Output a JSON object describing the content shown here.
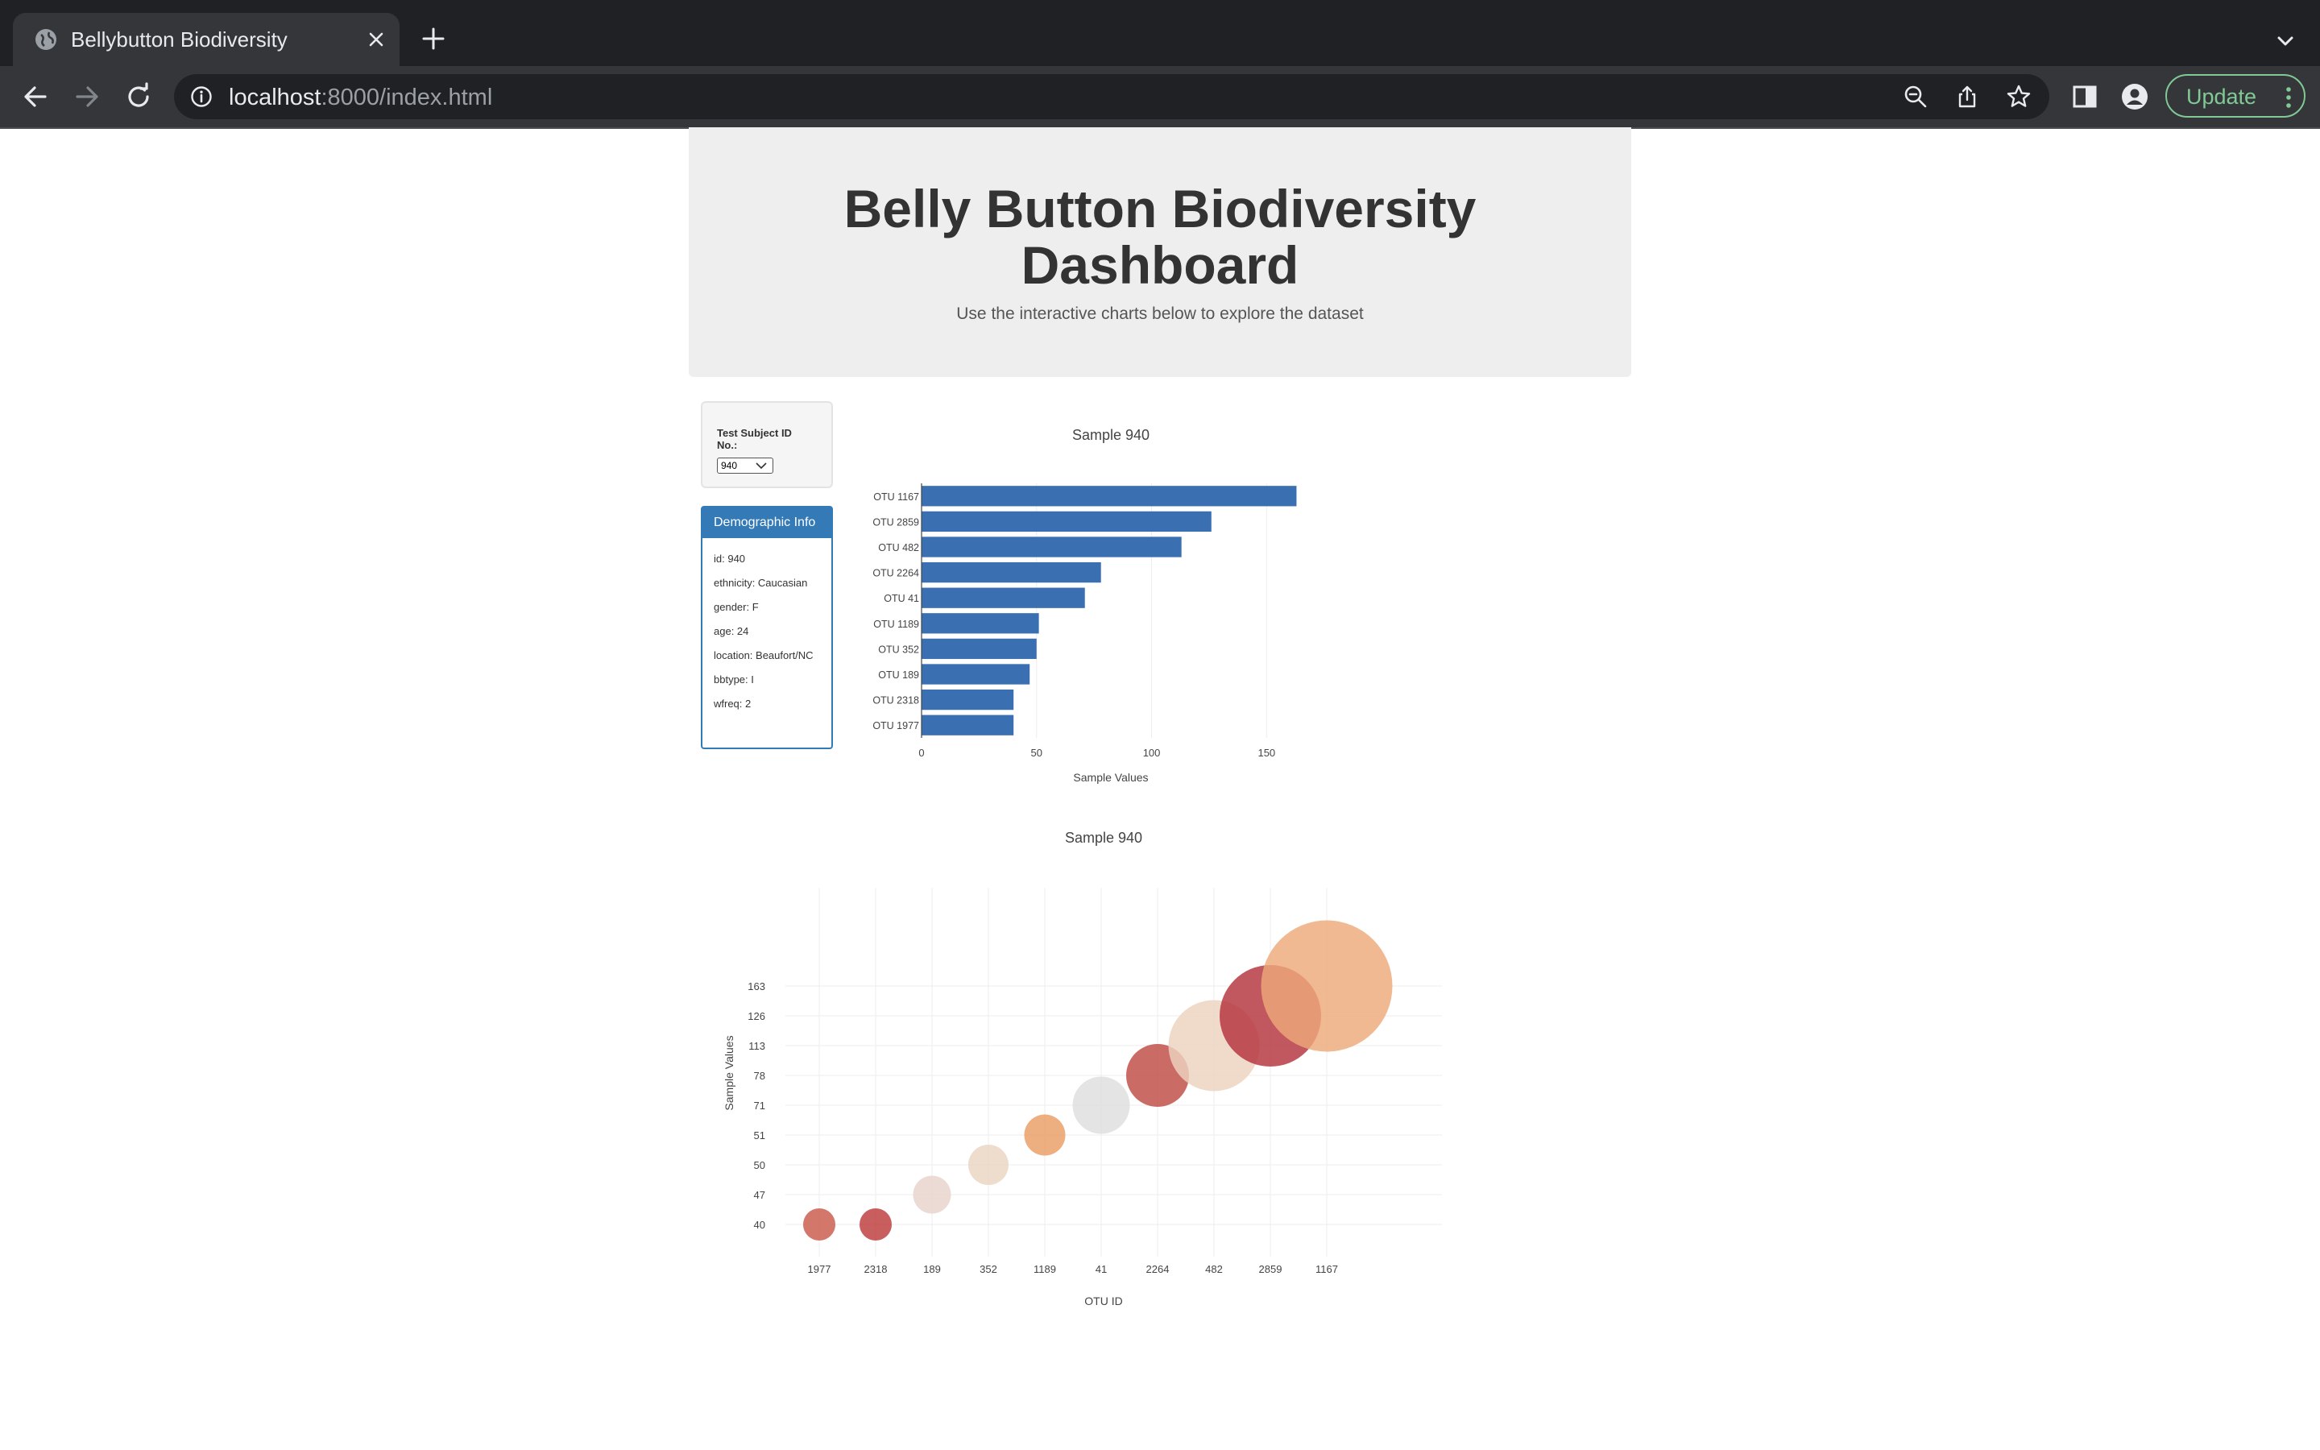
{
  "browser": {
    "tab_title": "Bellybutton Biodiversity",
    "url_host": "localhost",
    "url_rest": ":8000/index.html",
    "update_label": "Update"
  },
  "header": {
    "title_line1": "Belly Button Biodiversity",
    "title_line2": "Dashboard",
    "subtitle": "Use the interactive charts below to explore the dataset"
  },
  "selector": {
    "label": "Test Subject ID No.:",
    "selected": "940"
  },
  "demographics": {
    "heading": "Demographic Info",
    "rows": [
      "id: 940",
      "ethnicity: Caucasian",
      "gender: F",
      "age: 24",
      "location: Beaufort/NC",
      "bbtype: I",
      "wfreq: 2"
    ]
  },
  "chart_data": [
    {
      "type": "bar",
      "orientation": "horizontal",
      "title": "Sample 940",
      "xlabel": "Sample Values",
      "ylabel": "",
      "categories": [
        "OTU 1167",
        "OTU 2859",
        "OTU 482",
        "OTU 2264",
        "OTU 41",
        "OTU 1189",
        "OTU 352",
        "OTU 189",
        "OTU 2318",
        "OTU 1977"
      ],
      "values": [
        163,
        126,
        113,
        78,
        71,
        51,
        50,
        47,
        40,
        40
      ],
      "xticks": [
        0,
        50,
        100,
        150
      ],
      "xlim": [
        0,
        171.6
      ],
      "color": "#3a70b2",
      "grid": true
    },
    {
      "type": "scatter",
      "subtype": "bubble",
      "title": "Sample 940",
      "xlabel": "OTU ID",
      "ylabel": "Sample Values",
      "x_categories": [
        "1977",
        "2318",
        "189",
        "352",
        "1189",
        "41",
        "2264",
        "482",
        "2859",
        "1167"
      ],
      "y_categories": [
        "40",
        "47",
        "50",
        "51",
        "71",
        "78",
        "113",
        "126",
        "163"
      ],
      "points": [
        {
          "x": "1977",
          "y": "40",
          "value": 40
        },
        {
          "x": "2318",
          "y": "40",
          "value": 40
        },
        {
          "x": "189",
          "y": "47",
          "value": 47
        },
        {
          "x": "352",
          "y": "50",
          "value": 50
        },
        {
          "x": "1189",
          "y": "51",
          "value": 51
        },
        {
          "x": "41",
          "y": "71",
          "value": 71
        },
        {
          "x": "2264",
          "y": "78",
          "value": 78
        },
        {
          "x": "482",
          "y": "113",
          "value": 113
        },
        {
          "x": "2859",
          "y": "126",
          "value": 126
        },
        {
          "x": "1167",
          "y": "163",
          "value": 163
        }
      ],
      "colors": [
        "#c9594a",
        "#bd3b3b",
        "#e6d3cb",
        "#ead4c2",
        "#e99c64",
        "#dedede",
        "#c04a44",
        "#edd3c0",
        "#b3323c",
        "#edaa7a"
      ],
      "grid": true
    }
  ]
}
